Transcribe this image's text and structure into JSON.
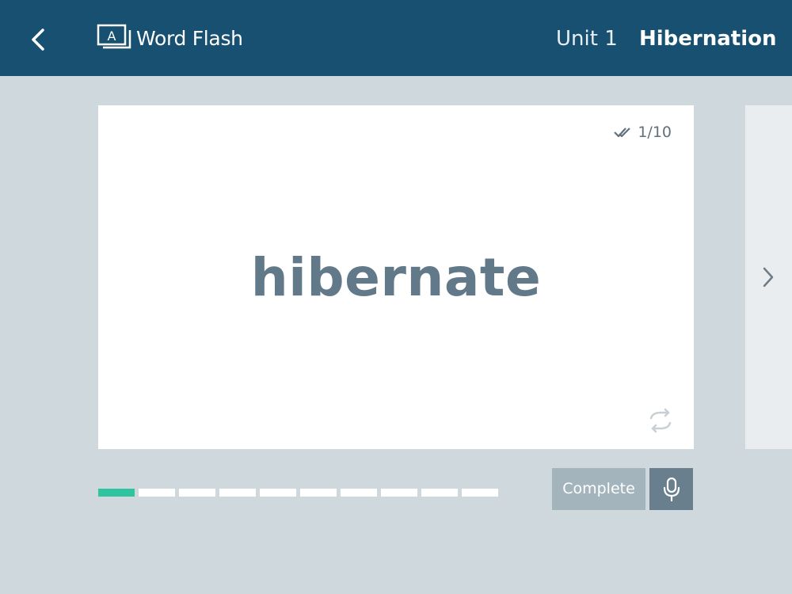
{
  "header": {
    "app_title": "Word Flash",
    "logo_letter": "A",
    "unit_label": "Unit 1",
    "lesson_title": "Hibernation"
  },
  "card": {
    "word": "hibernate",
    "counter": "1/10"
  },
  "progress": {
    "current": 1,
    "total": 10
  },
  "actions": {
    "complete_label": "Complete"
  },
  "icons": {
    "back": "chevron-left-icon",
    "logo": "flashcard-logo-icon",
    "counter": "double-check-icon",
    "flip": "flip-refresh-icon",
    "next": "chevron-right-icon",
    "mic": "microphone-icon"
  },
  "colors": {
    "header_bg": "#175070",
    "page_bg": "#cfd8dc",
    "progress_done": "#2ec4a0",
    "complete_button": "#a4b4bc",
    "mic_button": "#6a7f8d"
  }
}
